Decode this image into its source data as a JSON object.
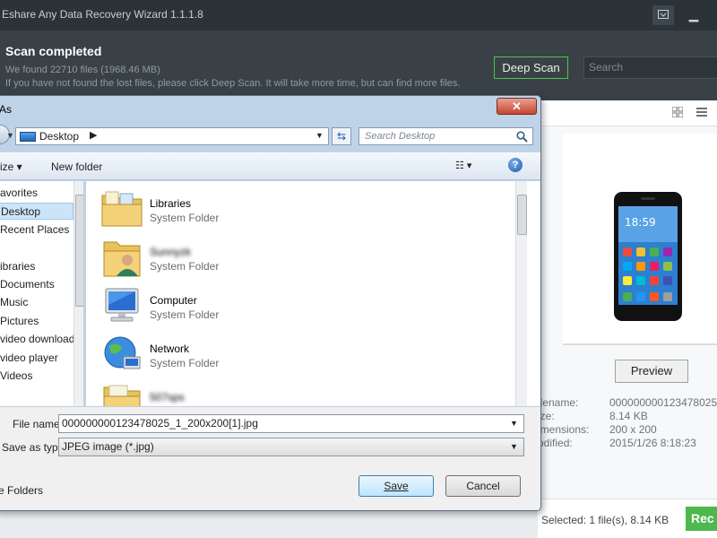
{
  "app": {
    "title": "Eshare Any Data Recovery Wizard 1.1.1.8",
    "menu_icon": "menu-icon",
    "minimize_icon": "minimize-icon",
    "header": {
      "status": "Scan completed",
      "found": "We found 22710 files (1968.46 MB)",
      "hint": "If you have not found the lost files, please click Deep Scan. It will take more time, but can find more files.",
      "deep_scan_label": "Deep Scan",
      "search_placeholder": "Search"
    },
    "preview": {
      "button_label": "Preview",
      "info": [
        {
          "label": "ilename:",
          "value": "000000000123478025"
        },
        {
          "label": "ize:",
          "value": "8.14 KB"
        },
        {
          "label": "imensions:",
          "value": "200 x 200"
        },
        {
          "label": "odified:",
          "value": "2015/1/26 8:18:23"
        }
      ]
    },
    "footer": {
      "selected": "Selected: 1 file(s), 8.14 KB",
      "recover_label": "Rec"
    },
    "accent_color": "#4db84d"
  },
  "dialog": {
    "title": "As",
    "close_label": "✕",
    "address": {
      "location": "Desktop",
      "arrow": "▶"
    },
    "search_placeholder": "Search Desktop",
    "organize_label": "ize ▾",
    "new_folder_label": "New folder",
    "help_label": "?",
    "nav_items": [
      {
        "label": "avorites"
      },
      {
        "label": "Desktop",
        "selected": true
      },
      {
        "label": "Recent Places"
      },
      {
        "label": ""
      },
      {
        "label": "ibraries"
      },
      {
        "label": "Documents"
      },
      {
        "label": "Music"
      },
      {
        "label": "Pictures"
      },
      {
        "label": "video downloade"
      },
      {
        "label": "video player"
      },
      {
        "label": "Videos"
      }
    ],
    "files": [
      {
        "name": "Libraries",
        "type": "System Folder",
        "icon": "libraries-icon"
      },
      {
        "name": "Sunnyzk",
        "type": "System Folder",
        "icon": "user-folder-icon",
        "blurred": true
      },
      {
        "name": "Computer",
        "type": "System Folder",
        "icon": "computer-icon"
      },
      {
        "name": "Network",
        "type": "System Folder",
        "icon": "network-icon"
      },
      {
        "name": "507sps",
        "type": "",
        "icon": "folder-icon",
        "blurred": true
      }
    ],
    "file_name_label": "File name:",
    "file_name_value": "000000000123478025_1_200x200[1].jpg",
    "save_type_label": "Save as type:",
    "save_type_value": "JPEG image (*.jpg)",
    "hide_folders_label": "e Folders",
    "save_label": "Save",
    "cancel_label": "Cancel"
  }
}
